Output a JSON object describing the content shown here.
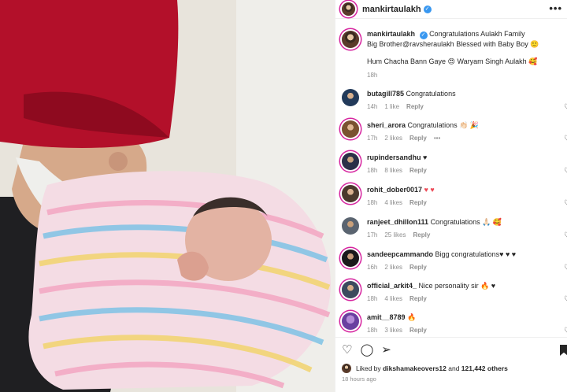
{
  "header": {
    "username": "mankirtaulakh",
    "more_label": "•••"
  },
  "caption": {
    "username": "mankirtaulakh",
    "line1": "Congratulations Aulakh Family",
    "line2": "Big Brother@ravsheraulakh Blessed with Baby Boy 🙂",
    "line3": "Hum Chacha Bann Gaye 😍 Waryam Singh Aulakh 🥰",
    "time": "18h"
  },
  "comments": [
    {
      "user": "butagill785",
      "text": "Congratulations",
      "time": "14h",
      "likes": "1 like",
      "reply": "Reply",
      "extra": ""
    },
    {
      "user": "sheri_arora",
      "text": "Congratulations 👏🏻 🎉",
      "time": "17h",
      "likes": "2 likes",
      "reply": "Reply",
      "extra": "•••"
    },
    {
      "user": "rupindersandhu",
      "text": "♥",
      "time": "18h",
      "likes": "8 likes",
      "reply": "Reply",
      "extra": ""
    },
    {
      "user": "rohit_dober0017",
      "text": "♥ ♥",
      "time": "18h",
      "likes": "4 likes",
      "reply": "Reply",
      "extra": ""
    },
    {
      "user": "ranjeet_dhillon111",
      "text": "Congratulations 🙏🏻 🥰",
      "time": "17h",
      "likes": "25 likes",
      "reply": "Reply",
      "extra": ""
    },
    {
      "user": "sandeepcammando",
      "text": "Bigg congratulations♥ ♥ ♥",
      "time": "16h",
      "likes": "2 likes",
      "reply": "Reply",
      "extra": ""
    },
    {
      "user": "official_arkit4_",
      "text": "Nice personality sir 🔥 ♥",
      "time": "18h",
      "likes": "4 likes",
      "reply": "Reply",
      "extra": ""
    },
    {
      "user": "amit__8789",
      "text": "🔥",
      "time": "18h",
      "likes": "3 likes",
      "reply": "Reply",
      "extra": ""
    }
  ],
  "likes": {
    "prefix": "Liked by",
    "user": "dikshamakeovers12",
    "and": "and",
    "count": "121,442 others"
  },
  "posted": "18 hours ago"
}
